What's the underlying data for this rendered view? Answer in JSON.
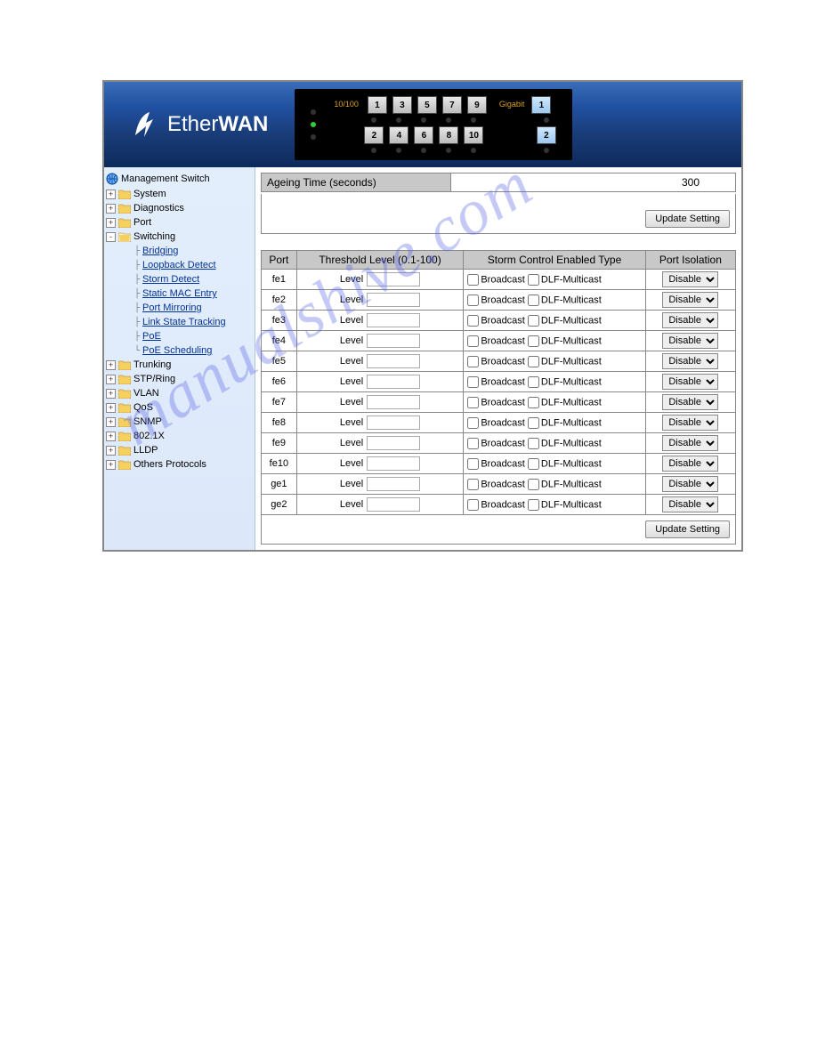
{
  "logo": {
    "thin": "Ether",
    "bold": "WAN"
  },
  "portPanel": {
    "label10_100": "10/100",
    "labelGigabit": "Gigabit",
    "top": [
      "1",
      "3",
      "5",
      "7",
      "9"
    ],
    "bottom": [
      "2",
      "4",
      "6",
      "8",
      "10"
    ],
    "gigTop": "1",
    "gigBottom": "2"
  },
  "sidebar": {
    "root": "Management Switch",
    "items": [
      {
        "label": "System",
        "type": "folder",
        "exp": "+"
      },
      {
        "label": "Diagnostics",
        "type": "folder",
        "exp": "+"
      },
      {
        "label": "Port",
        "type": "folder",
        "exp": "+"
      },
      {
        "label": "Switching",
        "type": "folder-open",
        "exp": "-",
        "children": [
          {
            "label": "Bridging"
          },
          {
            "label": "Loopback Detect"
          },
          {
            "label": "Storm Detect"
          },
          {
            "label": "Static MAC Entry"
          },
          {
            "label": "Port Mirroring"
          },
          {
            "label": "Link State Tracking"
          },
          {
            "label": "PoE"
          },
          {
            "label": "PoE Scheduling"
          }
        ]
      },
      {
        "label": "Trunking",
        "type": "folder",
        "exp": "+"
      },
      {
        "label": "STP/Ring",
        "type": "folder",
        "exp": "+"
      },
      {
        "label": "VLAN",
        "type": "folder",
        "exp": "+"
      },
      {
        "label": "QoS",
        "type": "folder",
        "exp": "+"
      },
      {
        "label": "SNMP",
        "type": "folder",
        "exp": "+"
      },
      {
        "label": "802.1X",
        "type": "folder",
        "exp": "+"
      },
      {
        "label": "LLDP",
        "type": "folder",
        "exp": "+"
      },
      {
        "label": "Others Protocols",
        "type": "folder",
        "exp": "+"
      }
    ]
  },
  "main": {
    "ageingLabel": "Ageing Time (seconds)",
    "ageingValue": "300",
    "updateBtn": "Update Setting",
    "headers": {
      "port": "Port",
      "threshold": "Threshold Level (0.1-100)",
      "storm": "Storm Control Enabled Type",
      "isolation": "Port Isolation"
    },
    "levelLabel": "Level",
    "broadcastLabel": "Broadcast",
    "dlfLabel": "DLF-Multicast",
    "isolationValue": "Disable",
    "ports": [
      "fe1",
      "fe2",
      "fe3",
      "fe4",
      "fe5",
      "fe6",
      "fe7",
      "fe8",
      "fe9",
      "fe10",
      "ge1",
      "ge2"
    ]
  },
  "watermark": "manualshive.com"
}
